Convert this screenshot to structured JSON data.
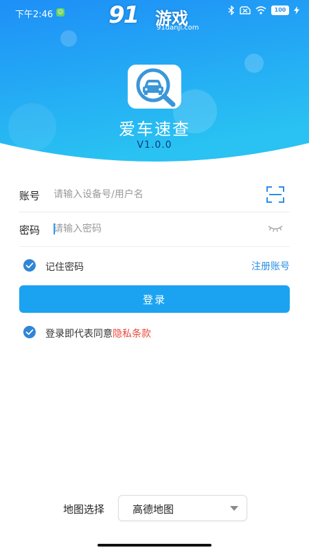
{
  "status_bar": {
    "time": "下午2:46",
    "battery": "100"
  },
  "watermark": {
    "number": "91",
    "text": "游戏",
    "domain": "91danji.com"
  },
  "app": {
    "title": "爱车速查",
    "version": "V1.0.0"
  },
  "form": {
    "account_label": "账号",
    "account_placeholder": "请输入设备号/用户名",
    "password_label": "密码",
    "password_placeholder": "请输入密码"
  },
  "remember": {
    "label": "记住密码",
    "checked": true
  },
  "register_link": "注册账号",
  "login_button": "登录",
  "agreement": {
    "text": "登录即代表同意",
    "link": "隐私条款",
    "checked": true
  },
  "map": {
    "label": "地图选择",
    "selected": "高德地图"
  },
  "colors": {
    "header_top": "#1e8ff7",
    "header_bottom": "#29c2f2",
    "primary": "#1ba3f2",
    "checkbox": "#2f86d6",
    "link": "#2a8ee6",
    "privacy": "#e84b3c"
  },
  "icons": {
    "logo": "car-search-icon",
    "account_action": "scan-icon",
    "password_action": "eye-closed-icon",
    "map_select": "triangle-down-icon"
  }
}
